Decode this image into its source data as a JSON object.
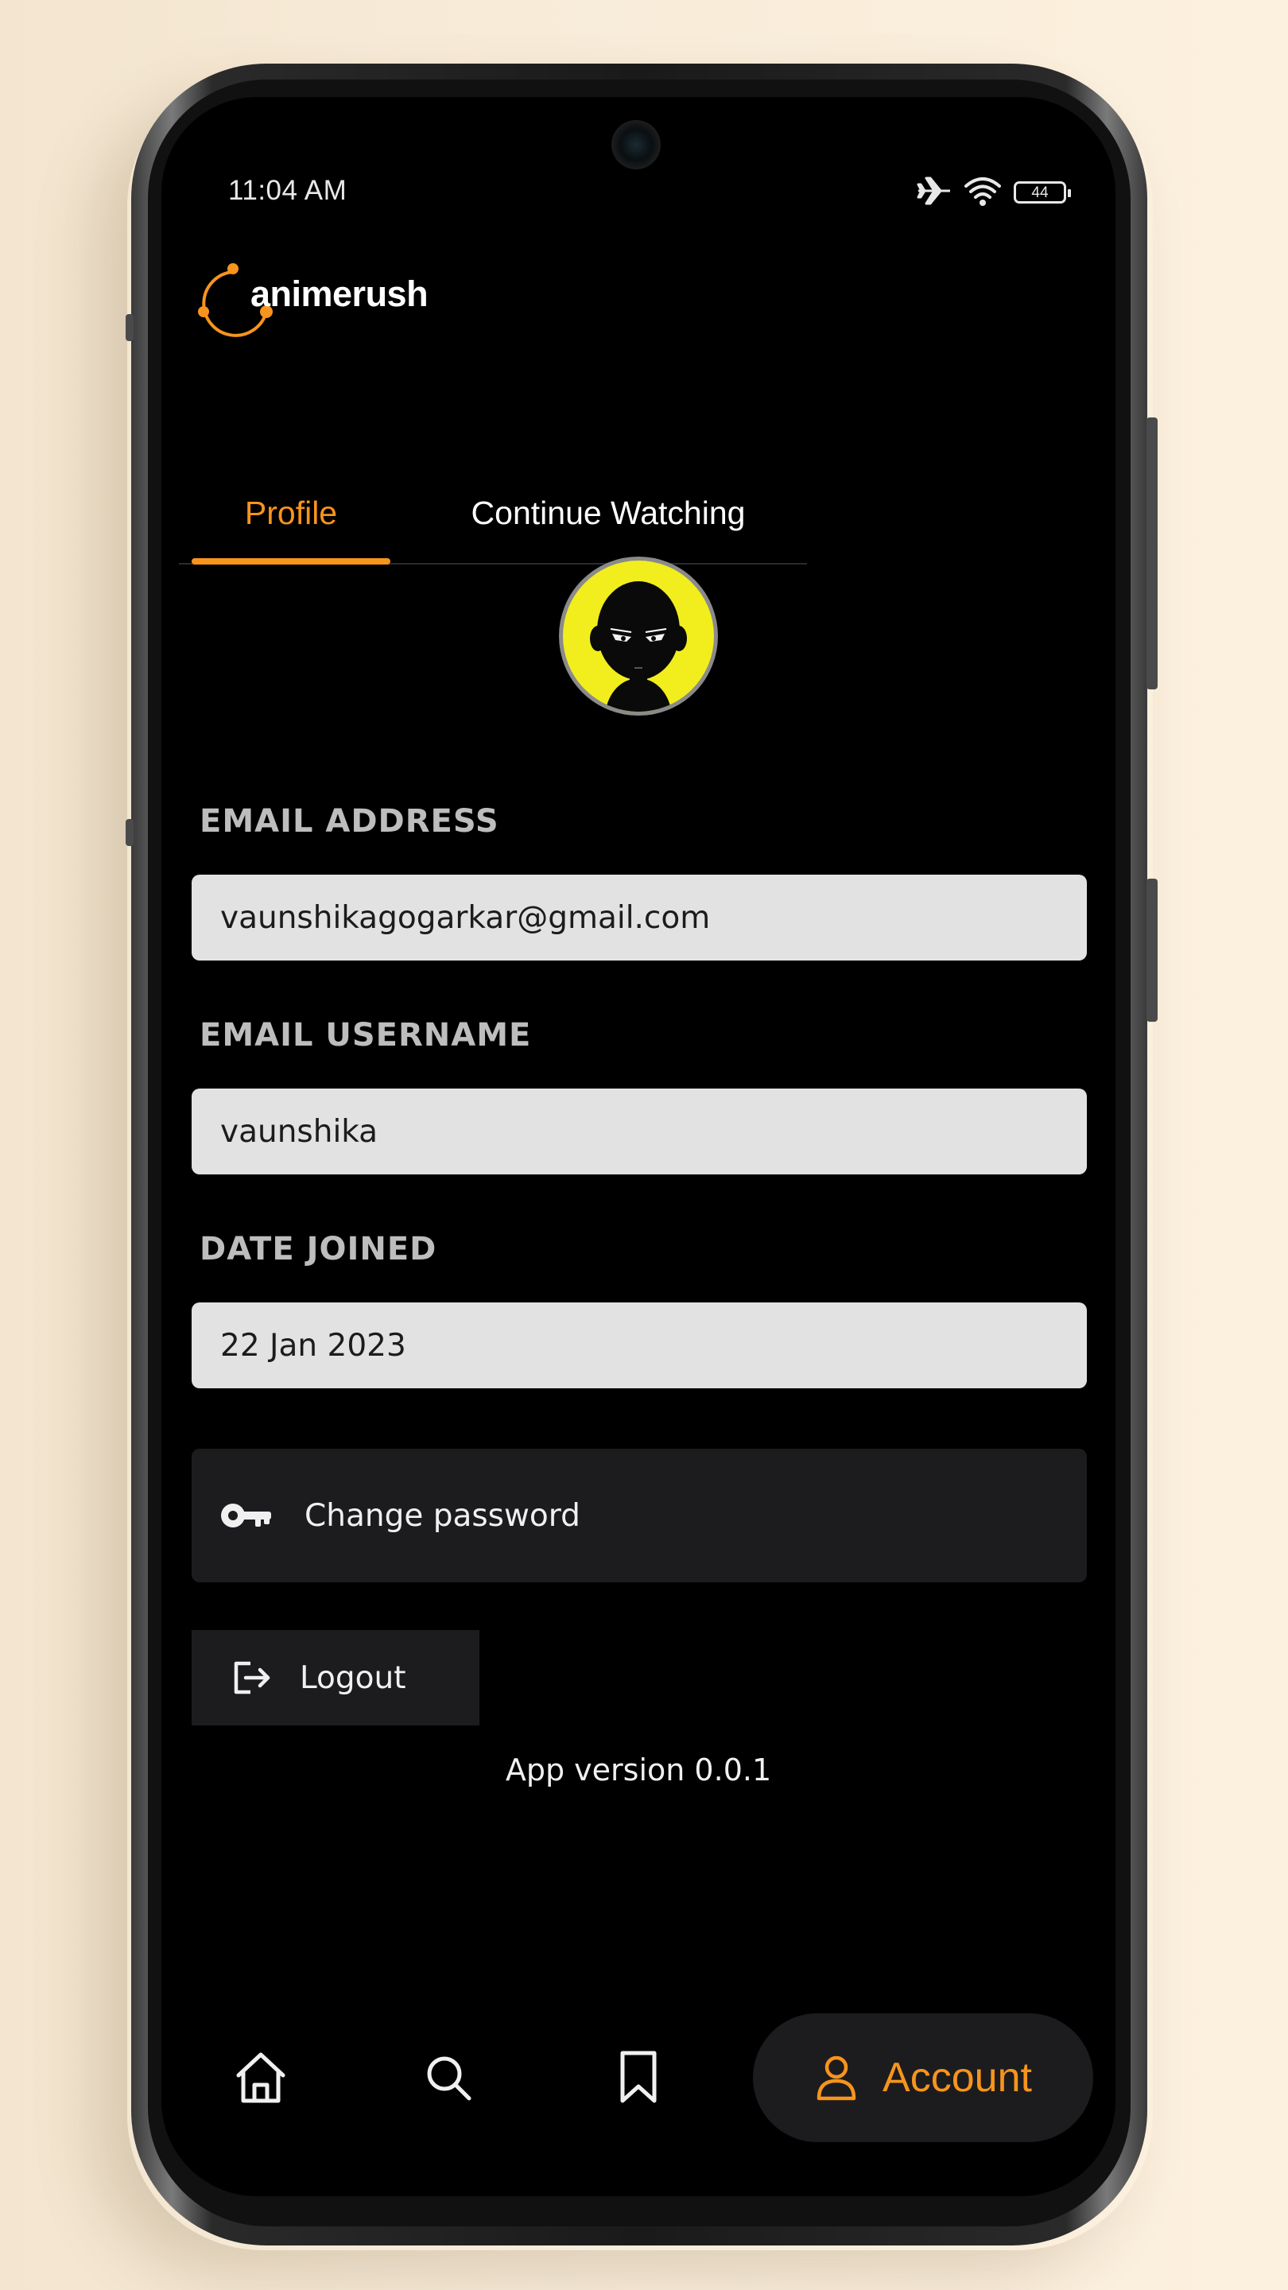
{
  "status_bar": {
    "time": "11:04 AM",
    "battery_level": "44",
    "icons": [
      "airplane-icon",
      "wifi-icon",
      "battery-icon"
    ]
  },
  "app": {
    "logo_text": "animerush",
    "accent_color": "#f7941d"
  },
  "tabs": [
    {
      "label": "Profile",
      "active": true
    },
    {
      "label": "Continue Watching",
      "active": false
    }
  ],
  "profile": {
    "avatar": "bald-character-avatar",
    "fields": [
      {
        "label": "EMAIL ADDRESS",
        "value": "vaunshikagogarkar@gmail.com"
      },
      {
        "label": "EMAIL USERNAME",
        "value": "vaunshika"
      },
      {
        "label": "DATE JOINED",
        "value": "22 Jan 2023"
      }
    ]
  },
  "actions": {
    "change_password": {
      "label": "Change password",
      "icon": "key-icon"
    },
    "logout": {
      "label": "Logout",
      "icon": "logout-icon"
    }
  },
  "app_version": "App version 0.0.1",
  "bottom_nav": {
    "items": [
      {
        "name": "home",
        "icon": "home-icon"
      },
      {
        "name": "search",
        "icon": "search-icon"
      },
      {
        "name": "bookmarks",
        "icon": "bookmark-icon"
      }
    ],
    "active": {
      "label": "Account",
      "icon": "user-icon"
    }
  }
}
